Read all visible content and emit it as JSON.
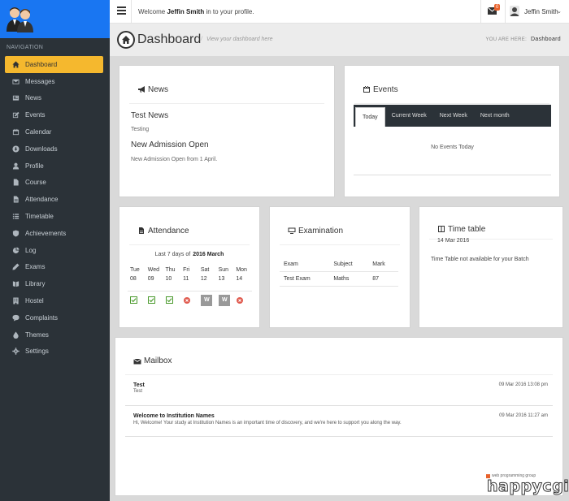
{
  "sidebar": {
    "nav_heading": "NAVIGATION",
    "items": [
      {
        "label": "Dashboard",
        "icon": "home-icon",
        "active": true
      },
      {
        "label": "Messages",
        "icon": "envelope-icon"
      },
      {
        "label": "News",
        "icon": "newspaper-icon"
      },
      {
        "label": "Events",
        "icon": "edit-icon"
      },
      {
        "label": "Calendar",
        "icon": "calendar-icon"
      },
      {
        "label": "Downloads",
        "icon": "download-icon"
      },
      {
        "label": "Profile",
        "icon": "user-icon"
      },
      {
        "label": "Course",
        "icon": "file-icon"
      },
      {
        "label": "Attendance",
        "icon": "file-text-icon"
      },
      {
        "label": "Timetable",
        "icon": "list-icon"
      },
      {
        "label": "Achievements",
        "icon": "shield-icon"
      },
      {
        "label": "Log",
        "icon": "pie-chart-icon"
      },
      {
        "label": "Exams",
        "icon": "pencil-icon"
      },
      {
        "label": "Library",
        "icon": "book-icon"
      },
      {
        "label": "Hostel",
        "icon": "building-icon"
      },
      {
        "label": "Complaints",
        "icon": "comment-icon"
      },
      {
        "label": "Themes",
        "icon": "tint-icon"
      },
      {
        "label": "Settings",
        "icon": "gear-icon"
      }
    ]
  },
  "header": {
    "welcome_prefix": "Welcome",
    "user_bold": "Jeffin Smith",
    "welcome_suffix": "in to your profile.",
    "mail_badge": "0",
    "user_name": "Jeffin Smith",
    "caret": "⌄"
  },
  "titlebar": {
    "title": "Dashboard",
    "subtitle": "View your dashboard here",
    "you_are_here": "YOU ARE HERE:",
    "crumb": "Dashboard"
  },
  "news": {
    "heading": "News",
    "items": [
      {
        "title": "Test News",
        "desc": "Testing"
      },
      {
        "title": "New Admission Open",
        "desc": "New Admission Open from 1 April."
      }
    ]
  },
  "events": {
    "heading": "Events",
    "tabs": [
      "Today",
      "Current Week",
      "Next Week",
      "Next month"
    ],
    "empty": "No Events Today"
  },
  "attendance": {
    "heading": "Attendance",
    "caption_prefix": "Last 7 days of",
    "caption_month": "2016 March",
    "days": [
      {
        "dow": "Tue",
        "date": "08",
        "status": "present"
      },
      {
        "dow": "Wed",
        "date": "09",
        "status": "present"
      },
      {
        "dow": "Thu",
        "date": "10",
        "status": "present"
      },
      {
        "dow": "Fri",
        "date": "11",
        "status": "absent"
      },
      {
        "dow": "Sat",
        "date": "12",
        "status": "weekend"
      },
      {
        "dow": "Sun",
        "date": "13",
        "status": "weekend"
      },
      {
        "dow": "Mon",
        "date": "14",
        "status": "absent"
      }
    ],
    "weekend_letter": "W"
  },
  "examination": {
    "heading": "Examination",
    "columns": [
      "Exam",
      "Subject",
      "Mark"
    ],
    "rows": [
      [
        "Test Exam",
        "Maths",
        "87"
      ]
    ]
  },
  "timetable": {
    "heading": "Time table",
    "date": "14 Mar 2016",
    "note": "Time Table not available for your Batch"
  },
  "mailbox": {
    "heading": "Mailbox",
    "messages": [
      {
        "subject": "Test",
        "body": "Test",
        "date": "09 Mar 2016 13:08 pm"
      },
      {
        "subject": "Welcome to Institution Names",
        "body": "Hi, Welcome! Your study at Institution Names is an important time of discovery, and we're here to support you along the way.",
        "date": "09 Mar 2016 11:27 am"
      }
    ]
  },
  "watermark": {
    "top": "web programming group",
    "main": "happycgi"
  },
  "colors": {
    "sidebar_bg": "#2b3238",
    "logo_bg": "#1976f2",
    "active_item": "#f5b82e",
    "badge": "#e8622c",
    "present": "#4a9a2c",
    "absent": "#e05a4e"
  }
}
